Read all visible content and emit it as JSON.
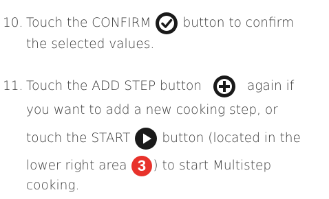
{
  "steps": [
    {
      "number": "10.",
      "line1_before": "Touch the CONFIRM",
      "line1_after": "button to confirm",
      "line2": "the selected values.",
      "icon": "check-circle-icon"
    },
    {
      "number": "11.",
      "line1_before": "Touch the ADD STEP button",
      "line1_after": "again if",
      "line2": "you want to add a new cooking step, or",
      "line3_before": "touch the START",
      "line3_after": "button (located in the",
      "line4_before": "lower right area",
      "line4_after": ") to start Multistep",
      "line5": "cooking.",
      "add_icon": "plus-circle-icon",
      "start_icon": "play-circle-icon",
      "area_badge": "3"
    }
  ],
  "colors": {
    "text": "#3a3a3a",
    "icon": "#1a1a1a",
    "badge": "#e8322b"
  }
}
